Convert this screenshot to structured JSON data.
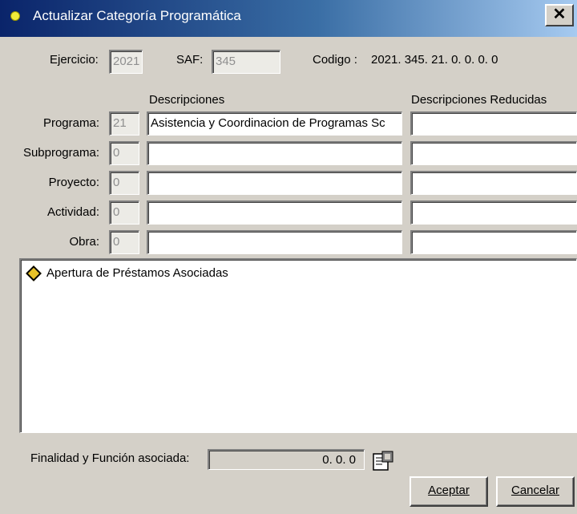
{
  "window": {
    "title": "Actualizar Categoría Programática",
    "close_label": "✕"
  },
  "header": {
    "ejercicio_label": "Ejercicio:",
    "ejercicio_value": "2021",
    "saf_label": "SAF:",
    "saf_value": "345",
    "codigo_label": "Codigo :",
    "codigo_value": "2021. 345. 21. 0. 0. 0. 0"
  },
  "columns": {
    "descripciones": "Descripciones",
    "descripciones_reducidas": "Descripciones Reducidas"
  },
  "rows": [
    {
      "label": "Programa:",
      "code": "21",
      "descripcion": "Asistencia y Coordinacion de Programas Sc",
      "reducida": ""
    },
    {
      "label": "Subprograma:",
      "code": "0",
      "descripcion": "",
      "reducida": ""
    },
    {
      "label": "Proyecto:",
      "code": "0",
      "descripcion": "",
      "reducida": ""
    },
    {
      "label": "Actividad:",
      "code": "0",
      "descripcion": "",
      "reducida": ""
    },
    {
      "label": "Obra:",
      "code": "0",
      "descripcion": "",
      "reducida": ""
    }
  ],
  "tree": {
    "items": [
      {
        "label": "Apertura de Préstamos Asociadas",
        "icon": "book-icon"
      }
    ]
  },
  "footer": {
    "finalidad_label": "Finalidad y Función asociada:",
    "finalidad_value": "0. 0. 0",
    "aceptar_label": "Aceptar",
    "cancelar_label": "Cancelar"
  }
}
